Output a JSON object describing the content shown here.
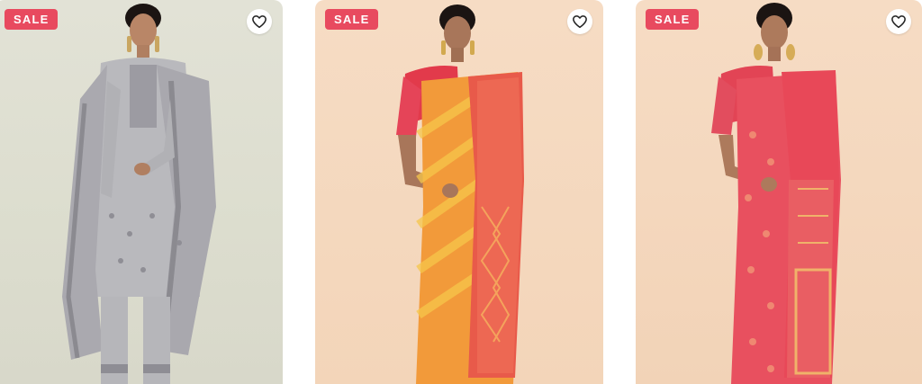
{
  "products": [
    {
      "badge": "SALE",
      "wishlist_icon": "heart-outline-icon",
      "image_subject": "model-grey-kurta-set"
    },
    {
      "badge": "SALE",
      "wishlist_icon": "heart-outline-icon",
      "image_subject": "model-orange-saree"
    },
    {
      "badge": "SALE",
      "wishlist_icon": "heart-outline-icon",
      "image_subject": "model-pink-saree"
    }
  ],
  "colors": {
    "sale_badge_bg": "#e84a5f",
    "sale_badge_text": "#ffffff",
    "wishlist_bg": "#ffffff"
  }
}
